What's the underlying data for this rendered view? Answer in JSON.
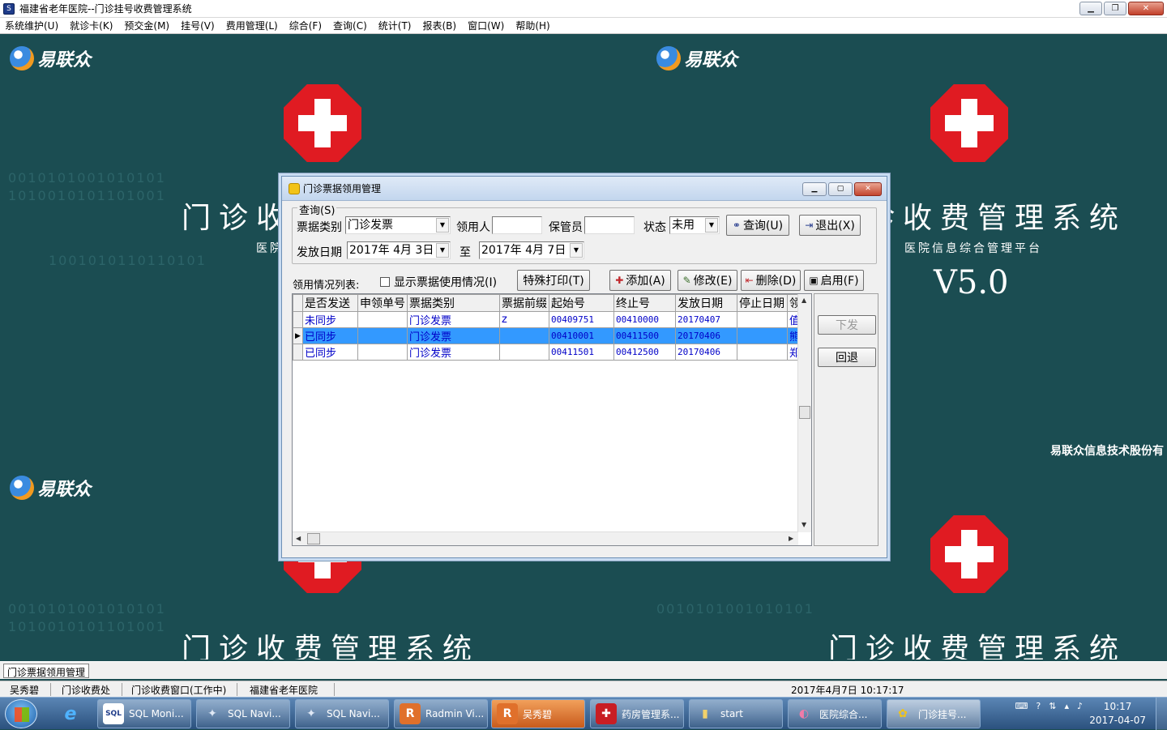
{
  "window": {
    "title": "福建省老年医院--门诊挂号收费管理系统",
    "min": "▁",
    "restore": "❐",
    "close": "✕"
  },
  "menu": [
    "系统维护(U)",
    "就诊卡(K)",
    "预交金(M)",
    "挂号(V)",
    "费用管理(L)",
    "综合(F)",
    "查询(C)",
    "统计(T)",
    "报表(B)",
    "窗口(W)",
    "帮助(H)"
  ],
  "desktop": {
    "logo": "易联众",
    "system_title": "门诊收费管理系统",
    "subtitle": "医院信息综合管理平台",
    "version": "V5.0",
    "company": "易联众信息技术股份有",
    "brand_color": "#1b4d52",
    "cross_color": "#e01b22"
  },
  "dialog": {
    "title": "门诊票据领用管理",
    "query_group": "查询(S)",
    "ticket_type_label": "票据类别",
    "ticket_type_value": "门诊发票",
    "receiver_label": "领用人",
    "receiver_value": "",
    "keeper_label": "保管员",
    "keeper_value": "",
    "status_label": "状态",
    "status_value": "未用",
    "query_button": "查询(U)",
    "exit_button": "退出(X)",
    "issue_date_label": "发放日期",
    "date_from": "2017年 4月 3日",
    "to_label": "至",
    "date_to": "2017年 4月 7日",
    "list_label": "领用情况列表:",
    "show_usage_checkbox": "显示票据使用情况(I)",
    "special_print_button": "特殊打印(T)",
    "add_button": "添加(A)",
    "edit_button": "修改(E)",
    "delete_button": "删除(D)",
    "enable_button": "启用(F)",
    "issue_button": "下发",
    "rollback_button": "回退",
    "table": {
      "columns": [
        "是否发送",
        "申领单号",
        "票据类别",
        "票据前缀",
        "起始号",
        "终止号",
        "发放日期",
        "停止日期",
        "领"
      ],
      "rows": [
        [
          "未同步",
          "",
          "门诊发票",
          "z",
          "00409751",
          "00410000",
          "20170407",
          "",
          "值"
        ],
        [
          "已同步",
          "",
          "门诊发票",
          "",
          "00410001",
          "00411500",
          "20170406",
          "",
          "熊"
        ],
        [
          "已同步",
          "",
          "门诊发票",
          "",
          "00411501",
          "00412500",
          "20170406",
          "",
          "郑"
        ]
      ],
      "selected_row": 1
    }
  },
  "status": {
    "tab": "门诊票据领用管理",
    "user": "吴秀碧",
    "dept": "门诊收费处",
    "window": "门诊收费窗口(工作中)",
    "hospital": "福建省老年医院",
    "datetime": "2017年4月7日 10:17:17"
  },
  "taskbar": {
    "tasks": [
      {
        "label": "SQL Moni...",
        "icon": "SQL"
      },
      {
        "label": "SQL Navi...",
        "icon": "✦"
      },
      {
        "label": "SQL Navi...",
        "icon": "✦"
      },
      {
        "label": "Radmin Vi...",
        "icon": "R"
      },
      {
        "label": "吴秀碧",
        "icon": "R"
      },
      {
        "label": "药房管理系...",
        "icon": "✚"
      },
      {
        "label": "start",
        "icon": "▮"
      },
      {
        "label": "医院综合...",
        "icon": "◐"
      },
      {
        "label": "门诊挂号...",
        "icon": "✿"
      }
    ],
    "time": "10:17",
    "date": "2017-04-07"
  }
}
